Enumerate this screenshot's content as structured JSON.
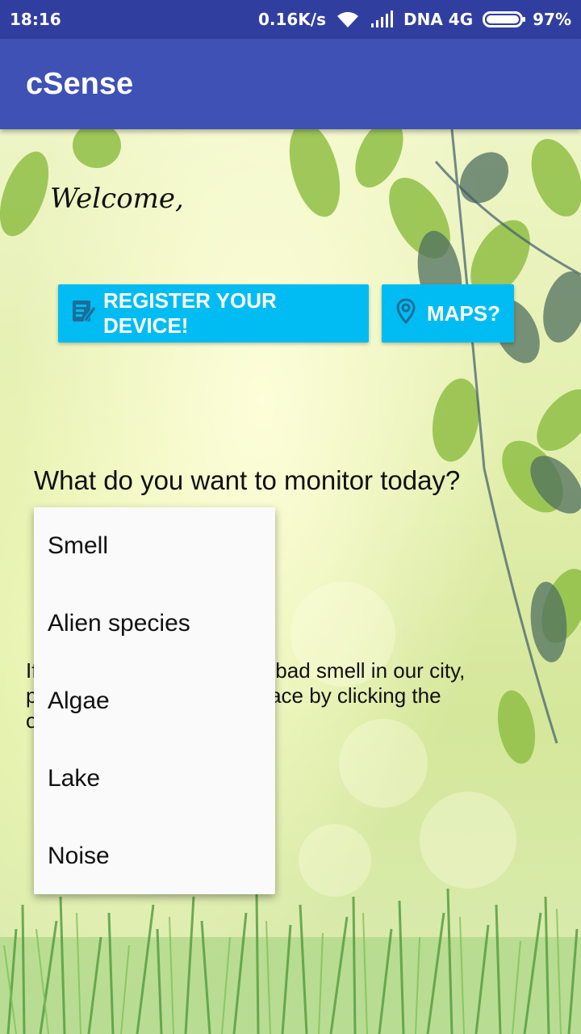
{
  "status_bar": {
    "time": "18:16",
    "speed": "0.16K/s",
    "network": "DNA 4G",
    "battery": "97%"
  },
  "app_bar": {
    "title": "cSense"
  },
  "welcome": "Welcome,",
  "buttons": {
    "register": "REGISTER YOUR DEVICE!",
    "maps": "MAPS?"
  },
  "question": "What do you want to monitor today?",
  "info_lines": [
    "If you are bothered by any bad smell in our city,",
    "please tell us about that place by clicking the",
    "o"
  ],
  "dropdown": {
    "options": [
      "Smell",
      "Alien species",
      "Algae",
      "Lake",
      "Noise"
    ]
  },
  "colors": {
    "status_bar": "#303f9f",
    "app_bar": "#3f51b5",
    "button": "#00bcf2",
    "menu": "#fafafa"
  },
  "icons": {
    "register": "edit-note-icon",
    "maps": "location-pin-icon"
  }
}
